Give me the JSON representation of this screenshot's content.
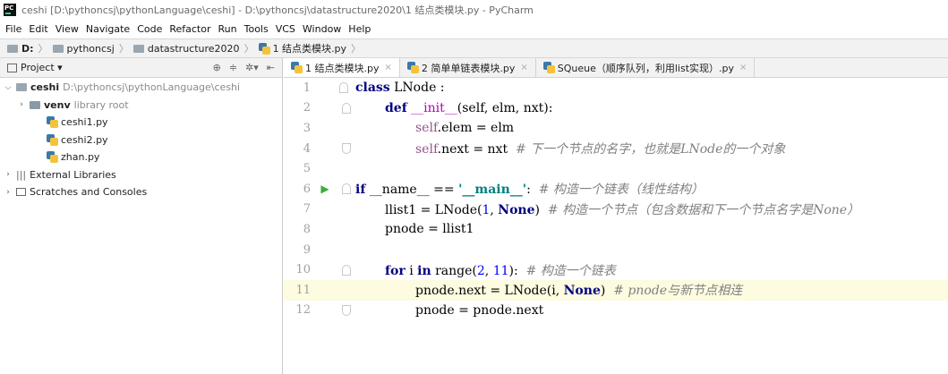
{
  "window": {
    "title": "ceshi [D:\\pythoncsj\\pythonLanguage\\ceshi] - D:\\pythoncsj\\datastructure2020\\1 结点类模块.py - PyCharm",
    "app_icon": "pycharm-icon"
  },
  "menu": [
    "File",
    "Edit",
    "View",
    "Navigate",
    "Code",
    "Refactor",
    "Run",
    "Tools",
    "VCS",
    "Window",
    "Help"
  ],
  "breadcrumbs": [
    "D:",
    "pythoncsj",
    "datastructure2020",
    "1 结点类模块.py"
  ],
  "project_panel": {
    "title": "Project",
    "tree": [
      {
        "label": "ceshi",
        "path": "D:\\pythoncsj\\pythonLanguage\\ceshi"
      },
      {
        "label": "venv",
        "note": "library root"
      },
      {
        "label": "ceshi1.py"
      },
      {
        "label": "ceshi2.py"
      },
      {
        "label": "zhan.py"
      },
      {
        "label": "External Libraries"
      },
      {
        "label": "Scratches and Consoles"
      }
    ]
  },
  "tabs": [
    {
      "label": "1 结点类模块.py"
    },
    {
      "label": "2 简单单链表模块.py"
    },
    {
      "label": "SQueue（顺序队列，利用list实现）.py"
    }
  ],
  "code": {
    "line_numbers": [
      "1",
      "2",
      "3",
      "4",
      "5",
      "6",
      "7",
      "8",
      "9",
      "10",
      "11",
      "12"
    ],
    "l1": {
      "kw": "class",
      "rest": " LNode :"
    },
    "l2": {
      "kw": "def",
      "name": "__init__",
      "args": "(self, elm, nxt):"
    },
    "l3": {
      "self": "self",
      "rest": ".elem = elm"
    },
    "l4": {
      "self": "self",
      "rest": ".next = nxt  ",
      "comment": "# 下一个节点的名字，也就是LNode的一个对象"
    },
    "l6": {
      "kw": "if",
      "name": "__name__",
      "op": " == ",
      "str": "'__main__'",
      "colon": ":  ",
      "comment": "# 构造一个链表（线性结构）"
    },
    "l7": {
      "pre": "llist1 = LNode(",
      "num": "1",
      "mid": ", ",
      "none": "None",
      "post": ")  ",
      "comment": "# 构造一个节点（包含数据和下一个节点名字是None）"
    },
    "l8": {
      "text": "pnode = llist1"
    },
    "l10": {
      "kw": "for",
      "a": " i ",
      "in": "in",
      "b": " range(",
      "n1": "2",
      "c": ", ",
      "n2": "11",
      "d": "):  ",
      "comment": "# 构造一个链表"
    },
    "l11": {
      "pre": "pnode.next = LNode(i, ",
      "none": "None",
      "post": ")  ",
      "comment": "# pnode与新节点相连"
    },
    "l12": {
      "text": "pnode = pnode.next"
    }
  }
}
